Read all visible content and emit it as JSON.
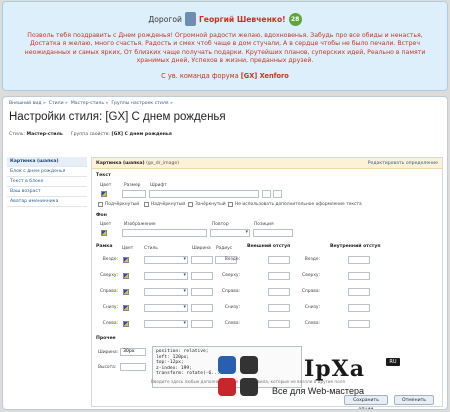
{
  "greeting": {
    "prefix": "Дорогой",
    "name": "Георгий Шевченко!",
    "age": "28",
    "body": "Позволь тебя поздравить с Днем рожденья! Огромной радости желаю, вдохновенья. Забудь про все обиды и ненастья, Достатка я желаю, много счастья. Радость и смех чтоб чаще в дом стучали, А в сердце чтобы не было печали. Встреч неожиданных и самых ярких, От близких чаще получать подарки. Крутейших планов, суперских идей, Реально в памяти хранимых дней, Успехов в жизни, преданных друзей.",
    "sign_prefix": "С ув. команда форума",
    "sign_name": "[GX] Xenforo"
  },
  "breadcrumbs": [
    "Внешний вид »",
    "Стили »",
    "Мастер-стиль »",
    "Группы настроек стиля »"
  ],
  "page_title": "Настройки стиля: [GX] С днем рожденья",
  "meta": {
    "style_label": "Стиль:",
    "style_value": "Мастер-стиль",
    "group_label": "Группа свойств:",
    "group_value": "[GX] С днем рожденья"
  },
  "sidebar": {
    "items": [
      {
        "label": "Картинка (шапка)",
        "active": true
      },
      {
        "label": "Блок с днем рожденья"
      },
      {
        "label": "Текст в блоке"
      },
      {
        "label": "Ваш возраст"
      },
      {
        "label": "Аватар именинника"
      }
    ]
  },
  "content": {
    "header_title": "Картинка (шапка)",
    "header_code": "(gx_dr_image)",
    "header_link": "Редактировать определение",
    "text_section": "Текст",
    "text_labels": {
      "color": "Цвет",
      "size": "Размер",
      "font": "Шрифт"
    },
    "checkboxes": [
      "Подчёркнутый",
      "Надчёркнутый",
      "Зачёркнутый",
      "Не использовать дополнительное оформление текста"
    ],
    "bg_section": "Фон",
    "bg_labels": {
      "color": "Цвет",
      "image": "Изображение",
      "repeat": "Повтор",
      "position": "Позиция"
    },
    "border_section": "Рамка",
    "border_cols": {
      "color": "Цвет",
      "style": "Стиль",
      "width": "Ширина",
      "radius": "Радиус"
    },
    "outer_section": "Внешний отступ",
    "inner_section": "Внутренний отступ",
    "rows": [
      "Везде:",
      "Сверху:",
      "Справа:",
      "Снизу:",
      "Слева:"
    ],
    "other_section": "Прочее",
    "width_label": "Ширина:",
    "width_value": "30px",
    "height_label": "Высота:",
    "code_lines": [
      "position: relative;",
      "left: 120px;",
      "top:-12px;",
      "z-index: 199;",
      "transform: rotate(-6..."
    ],
    "hint": "Введите здесь любые дополнительные CSS-правила, которые не влезли в другие поля"
  },
  "buttons": {
    "save": "Сохранить опции",
    "cancel": "Отменить"
  },
  "watermark": {
    "brand": "IpXa",
    "ru": "RU",
    "tagline": "Все для Web-мастера"
  }
}
